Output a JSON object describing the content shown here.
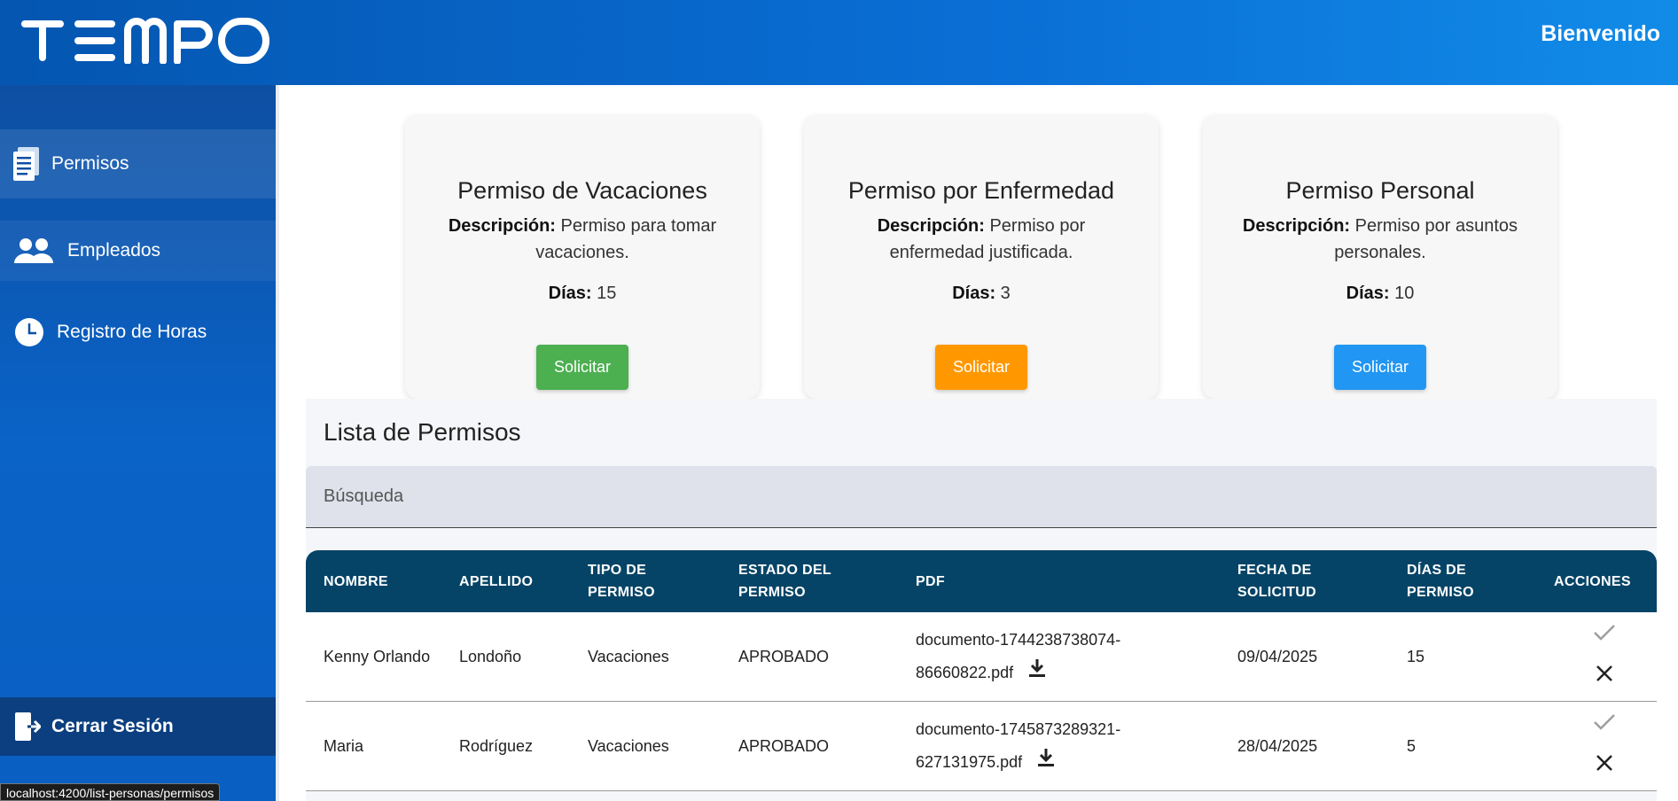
{
  "header": {
    "logo_text": "TEMPO",
    "welcome": "Bienvenido"
  },
  "sidebar": {
    "items": [
      {
        "label": "Permisos",
        "icon": "document-icon"
      },
      {
        "label": "Empleados",
        "icon": "people-icon"
      },
      {
        "label": "Registro de Horas",
        "icon": "clock-icon"
      }
    ],
    "logout": {
      "label": "Cerrar Sesión",
      "icon": "logout-icon"
    }
  },
  "status_bar": {
    "url": "localhost:4200/list-personas/permisos"
  },
  "cards": [
    {
      "title": "Permiso de Vacaciones",
      "desc_label": "Descripción:",
      "desc_text": "Permiso para tomar vacaciones.",
      "days_label": "Días:",
      "days": "15",
      "button": "Solicitar",
      "color": "#4caf50"
    },
    {
      "title": "Permiso por Enfermedad",
      "desc_label": "Descripción:",
      "desc_text": "Permiso por enfermedad justificada.",
      "days_label": "Días:",
      "days": "3",
      "button": "Solicitar",
      "color": "#ff9800"
    },
    {
      "title": "Permiso Personal",
      "desc_label": "Descripción:",
      "desc_text": "Permiso por asuntos personales.",
      "days_label": "Días:",
      "days": "10",
      "button": "Solicitar",
      "color": "#2196f3"
    }
  ],
  "list": {
    "title": "Lista de Permisos",
    "search_placeholder": "Búsqueda",
    "columns": [
      "NOMBRE",
      "APELLIDO",
      "TIPO DE PERMISO",
      "ESTADO DEL PERMISO",
      "PDF",
      "FECHA DE SOLICITUD",
      "DÍAS DE PERMISO",
      "ACCIONES"
    ],
    "rows": [
      {
        "nombre": "Kenny Orlando",
        "apellido": "Londoño",
        "tipo": "Vacaciones",
        "estado": "APROBADO",
        "pdf_line1": "documento-1744238738074-",
        "pdf_line2": "86660822.pdf",
        "fecha": "09/04/2025",
        "dias": "15"
      },
      {
        "nombre": "Maria",
        "apellido": "Rodríguez",
        "tipo": "Vacaciones",
        "estado": "APROBADO",
        "pdf_line1": "documento-1745873289321-",
        "pdf_line2": "627131975.pdf",
        "fecha": "28/04/2025",
        "dias": "5"
      }
    ]
  }
}
